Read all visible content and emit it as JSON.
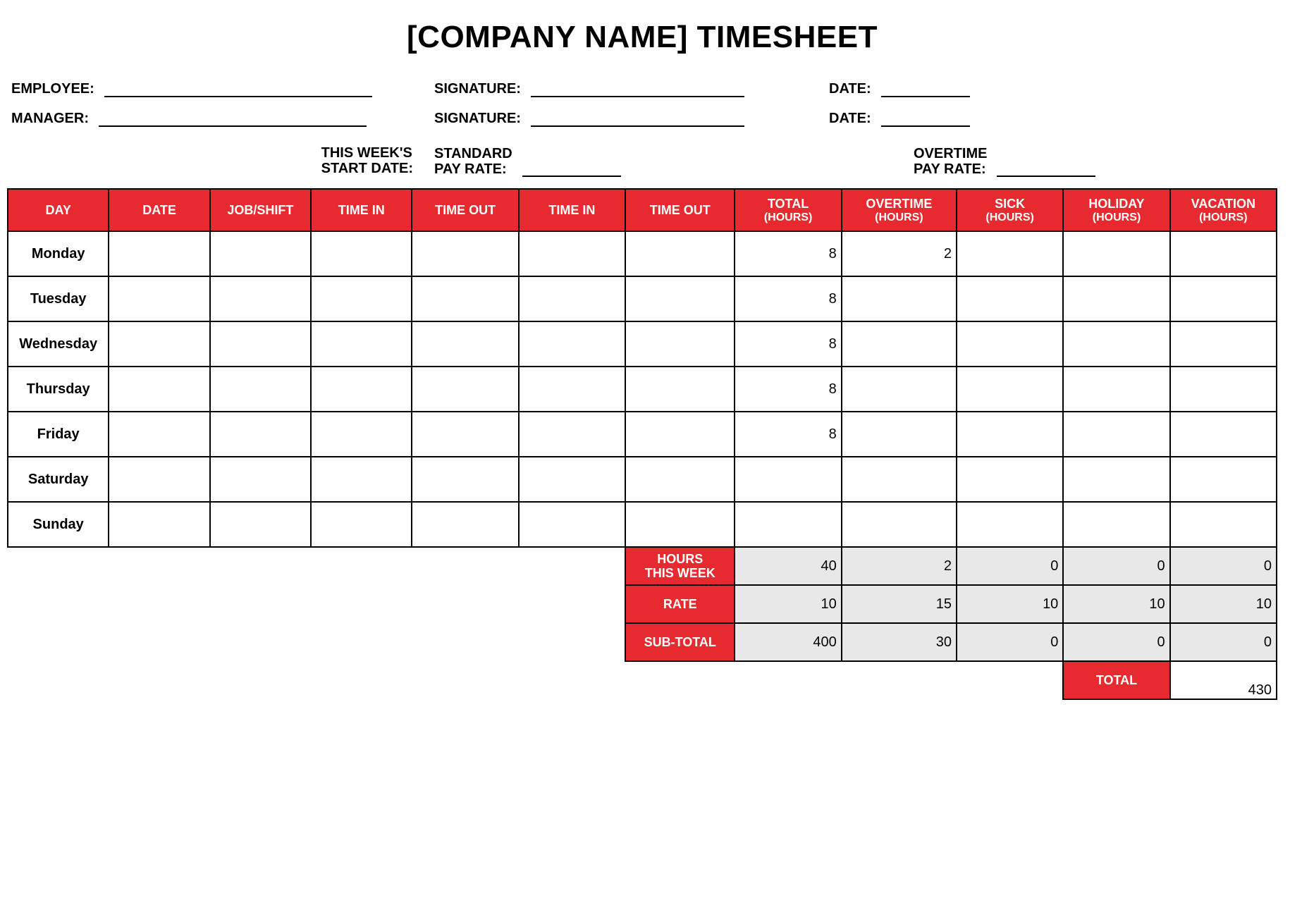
{
  "title": "[COMPANY NAME] TIMESHEET",
  "labels": {
    "employee": "EMPLOYEE:",
    "manager": "MANAGER:",
    "signature": "SIGNATURE:",
    "date": "DATE:",
    "week_start": "THIS WEEK'S\nSTART DATE:",
    "std_rate": "STANDARD\nPAY RATE:",
    "ot_rate": "OVERTIME\nPAY RATE:"
  },
  "columns": [
    "DAY",
    "DATE",
    "JOB/SHIFT",
    "TIME IN",
    "TIME OUT",
    "TIME IN",
    "TIME OUT",
    "TOTAL (HOURS)",
    "OVERTIME (HOURS)",
    "SICK (HOURS)",
    "HOLIDAY (HOURS)",
    "VACATION (HOURS)"
  ],
  "rows": [
    {
      "day": "Monday",
      "total": "8",
      "overtime": "2",
      "sick": "",
      "holiday": "",
      "vacation": ""
    },
    {
      "day": "Tuesday",
      "total": "8",
      "overtime": "",
      "sick": "",
      "holiday": "",
      "vacation": ""
    },
    {
      "day": "Wednesday",
      "total": "8",
      "overtime": "",
      "sick": "",
      "holiday": "",
      "vacation": ""
    },
    {
      "day": "Thursday",
      "total": "8",
      "overtime": "",
      "sick": "",
      "holiday": "",
      "vacation": ""
    },
    {
      "day": "Friday",
      "total": "8",
      "overtime": "",
      "sick": "",
      "holiday": "",
      "vacation": ""
    },
    {
      "day": "Saturday",
      "total": "",
      "overtime": "",
      "sick": "",
      "holiday": "",
      "vacation": ""
    },
    {
      "day": "Sunday",
      "total": "",
      "overtime": "",
      "sick": "",
      "holiday": "",
      "vacation": ""
    }
  ],
  "summary": {
    "hours_label": "HOURS THIS WEEK",
    "rate_label": "RATE",
    "subtotal_label": "SUB-TOTAL",
    "total_label": "TOTAL",
    "hours": {
      "total": "40",
      "overtime": "2",
      "sick": "0",
      "holiday": "0",
      "vacation": "0"
    },
    "rate": {
      "total": "10",
      "overtime": "15",
      "sick": "10",
      "holiday": "10",
      "vacation": "10"
    },
    "subtotal": {
      "total": "400",
      "overtime": "30",
      "sick": "0",
      "holiday": "0",
      "vacation": "0"
    },
    "grand_total": "430"
  }
}
